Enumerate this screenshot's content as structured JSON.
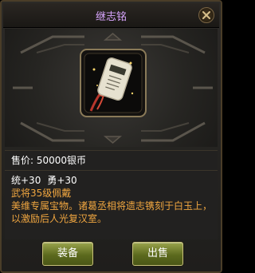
{
  "window": {
    "title": "继志铭"
  },
  "item": {
    "price_label": "售价:",
    "price_value": "50000银币",
    "attributes": [
      "统+30",
      "勇+30"
    ],
    "requirement": "武将35级佩戴",
    "flavor": "美维专属宝物。诸葛丞相将遗志镌刻于白玉上，以激励后人光复汉室。"
  },
  "buttons": {
    "equip": "装备",
    "sell": "出售"
  },
  "icons": {
    "close": "close-icon",
    "item": "jade-pendant-icon"
  }
}
